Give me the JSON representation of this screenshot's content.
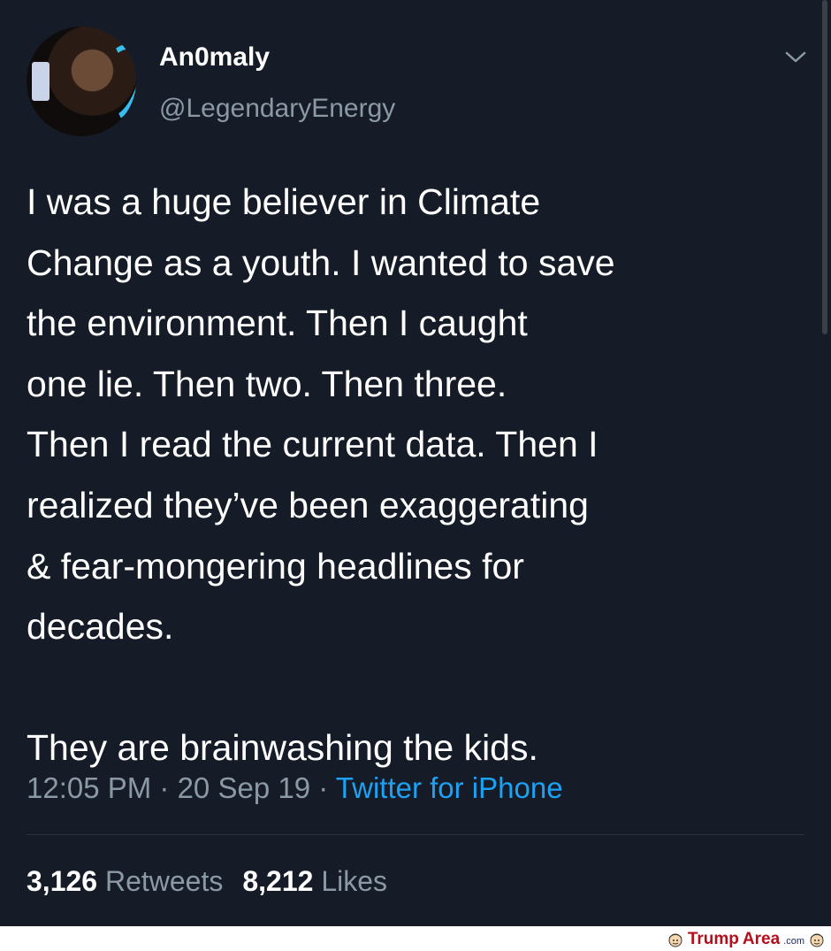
{
  "tweet": {
    "display_name": "An0maly",
    "handle": "@LegendaryEnergy",
    "text": "I was a huge believer in Climate\nChange as a youth. I wanted to save\nthe environment. Then I caught\none lie. Then two. Then three.\nThen I read the current data. Then I\nrealized they’ve been exaggerating\n& fear-mongering headlines for\ndecades.\n\nThey are brainwashing the kids.",
    "time": "12:05 PM",
    "separator": " · ",
    "date": "20 Sep 19",
    "source": "Twitter for iPhone",
    "retweets_count": "3,126",
    "retweets_label": "Retweets",
    "likes_count": "8,212",
    "likes_label": "Likes"
  },
  "icons": {
    "menu": "chevron-down-icon",
    "watermark_face": "cartoon-face-icon"
  },
  "watermark": {
    "part1": "Trump",
    "part2": "Area",
    "part3": ".com"
  },
  "colors": {
    "background": "#151c27",
    "text_primary": "#ffffff",
    "text_secondary": "#8b98a5",
    "link": "#1da1f2",
    "watermark_red": "#b1101c"
  }
}
